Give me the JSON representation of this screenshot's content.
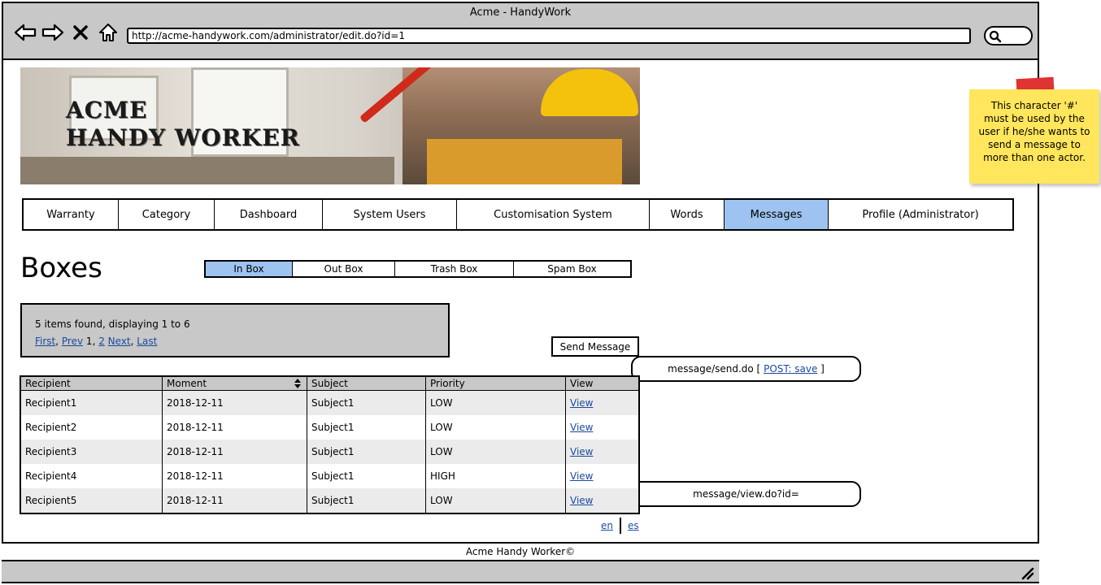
{
  "browser": {
    "title": "Acme - HandyWork",
    "url": "http://acme-handywork.com/administrator/edit.do?id=1"
  },
  "banner": {
    "line1": "ACME",
    "line2": "HANDY WORKER"
  },
  "sticky_note": "This character '#' must be used by the user if he/she wants to send a message to more than one actor.",
  "nav": [
    "Warranty",
    "Category",
    "Dashboard",
    "System Users",
    "Customisation System",
    "Words",
    "Messages",
    "Profile (Administrator)"
  ],
  "nav_active": "Messages",
  "page_title": "Boxes",
  "boxes": [
    "In Box",
    "Out Box",
    "Trash Box",
    "Spam Box"
  ],
  "boxes_active": "In Box",
  "pager": {
    "summary": "5 items found, displaying 1 to 6",
    "first": "First",
    "prev": "Prev",
    "current": "1",
    "page2": "2",
    "next": "Next",
    "last": "Last"
  },
  "send_message": "Send Message",
  "callouts": {
    "send_prefix": "message/send.do [",
    "send_link": "POST: save",
    "send_suffix": "]",
    "view": "message/view.do?id="
  },
  "table": {
    "headers": [
      "Recipient",
      "Moment",
      "Subject",
      "Priority",
      "View"
    ],
    "rows": [
      [
        "Recipient1",
        "2018-12-11",
        "Subject1",
        "LOW",
        "View"
      ],
      [
        "Recipient2",
        "2018-12-11",
        "Subject1",
        "LOW",
        "View"
      ],
      [
        "Recipient3",
        "2018-12-11",
        "Subject1",
        "LOW",
        "View"
      ],
      [
        "Recipient4",
        "2018-12-11",
        "Subject1",
        "HIGH",
        "View"
      ],
      [
        "Recipient5",
        "2018-12-11",
        "Subject1",
        "LOW",
        "View"
      ]
    ]
  },
  "languages": [
    "en",
    "es"
  ],
  "footer": "Acme Handy Worker©",
  "colors": {
    "active_tab": "#9ec3f0",
    "chrome_gray": "#c8c8c8",
    "sticky": "#ffe65c",
    "link": "#1a4a9e"
  }
}
